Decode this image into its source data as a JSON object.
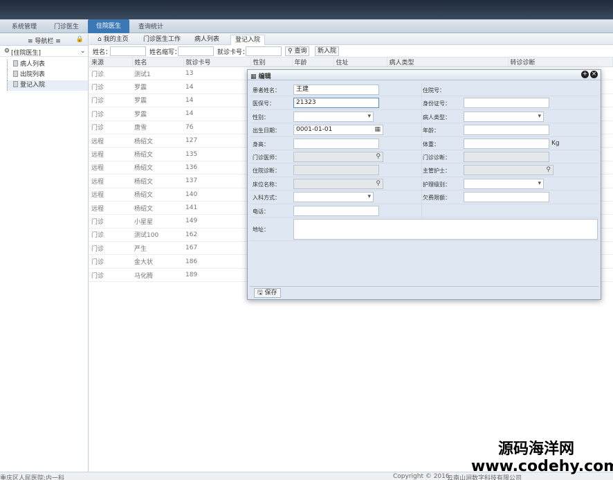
{
  "main_nav": [
    "系统管理",
    "门诊医生",
    "住院医生",
    "查询统计"
  ],
  "active_nav": "住院医生",
  "sidebar": {
    "title": "导航栏",
    "selector": "[住院医生]",
    "items": [
      "病人列表",
      "出院列表",
      "登记入院"
    ]
  },
  "tabs": [
    "我的主页",
    "门诊医生工作",
    "病人列表",
    "登记入院"
  ],
  "search": {
    "name_label": "姓名：",
    "abbr_label": "姓名缩写：",
    "card_label": "就诊卡号：",
    "query_button": "查询",
    "admit_button": "新入院"
  },
  "table": {
    "columns": [
      "来源",
      "姓名",
      "就诊卡号",
      "性别",
      "年龄",
      "住址",
      "病人类型",
      "转诊诊断"
    ],
    "rows": [
      [
        "门诊",
        "测试1",
        "13"
      ],
      [
        "门诊",
        "罗震",
        "14"
      ],
      [
        "门诊",
        "罗震",
        "14"
      ],
      [
        "门诊",
        "罗震",
        "14"
      ],
      [
        "门诊",
        "唐雪",
        "76"
      ],
      [
        "远程",
        "杨绍文",
        "127"
      ],
      [
        "远程",
        "杨绍文",
        "135"
      ],
      [
        "远程",
        "杨绍文",
        "136"
      ],
      [
        "远程",
        "杨绍文",
        "137"
      ],
      [
        "远程",
        "杨绍文",
        "140"
      ],
      [
        "远程",
        "杨绍文",
        "141"
      ],
      [
        "门诊",
        "小星星",
        "149"
      ],
      [
        "门诊",
        "测试100",
        "162"
      ],
      [
        "门诊",
        "严生",
        "167"
      ],
      [
        "门诊",
        "金大状",
        "186"
      ],
      [
        "门诊",
        "马化腾",
        "189"
      ]
    ]
  },
  "dialog": {
    "title": "编辑",
    "labels": {
      "patient_name": "患者姓名：",
      "insurance_no": "医保号：",
      "gender": "性别：",
      "birth_date": "出生日期：",
      "height": "身高：",
      "clinic_doctor": "门诊医师：",
      "admit_diag": "住院诊断：",
      "bed_name": "床位名称：",
      "admit_mode": "入科方式：",
      "phone": "电话：",
      "address": "地址：",
      "hosp_no": "住院号：",
      "id_card": "身份证号：",
      "patient_type": "病人类型：",
      "age": "年龄：",
      "weight": "体重：",
      "clinic_diag": "门诊诊断：",
      "nurse": "主管护士：",
      "care_level": "护理级别：",
      "arrears": "欠费限额："
    },
    "values": {
      "patient_name": "王建",
      "insurance_no": "21323",
      "birth_date": "0001-01-01"
    },
    "weight_unit": "Kg",
    "save_button": "保存"
  },
  "footer": {
    "left": "重庆区人民医院:内一科",
    "copyright": "Copyright © 2016",
    "company": "云南山涧数字科技有限公司"
  },
  "watermark": [
    "源码海洋网",
    "www.codehy.com"
  ]
}
